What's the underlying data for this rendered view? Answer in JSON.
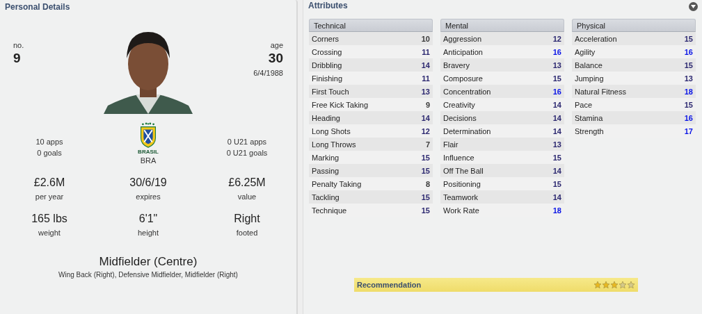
{
  "personal": {
    "title": "Personal Details",
    "number_label": "no.",
    "number": "9",
    "age_label": "age",
    "age": "30",
    "birth_date": "6/4/1988",
    "photo": {
      "kind": "picture"
    },
    "apps": [
      "10 apps",
      "0 goals"
    ],
    "crest_label": "BRASIL",
    "nation": "BRA",
    "u21": [
      "0 U21 apps",
      "0 U21 goals"
    ],
    "stats": [
      {
        "value": "£2.6M",
        "label": "per year"
      },
      {
        "value": "30/6/19",
        "label": "expires"
      },
      {
        "value": "£6.25M",
        "label": "value"
      },
      {
        "value": "165 lbs",
        "label": "weight"
      },
      {
        "value": "6'1\"",
        "label": "height"
      },
      {
        "value": "Right",
        "label": "footed"
      }
    ],
    "position": "Midfielder (Centre)",
    "other_positions": "Wing Back (Right), Defensive Midfielder, Midfielder (Right)"
  },
  "attributes": {
    "title": "Attributes",
    "groups": [
      {
        "title": "Technical",
        "items": [
          {
            "name": "Corners",
            "value": "10",
            "color": "#3a3a3a"
          },
          {
            "name": "Crossing",
            "value": "11",
            "color": "#2c2870"
          },
          {
            "name": "Dribbling",
            "value": "14",
            "color": "#2c2870"
          },
          {
            "name": "Finishing",
            "value": "11",
            "color": "#2c2870"
          },
          {
            "name": "First Touch",
            "value": "13",
            "color": "#2c2870"
          },
          {
            "name": "Free Kick Taking",
            "value": "9",
            "color": "#3a3a3a"
          },
          {
            "name": "Heading",
            "value": "14",
            "color": "#2c2870"
          },
          {
            "name": "Long Shots",
            "value": "12",
            "color": "#2c2870"
          },
          {
            "name": "Long Throws",
            "value": "7",
            "color": "#3a3a3a"
          },
          {
            "name": "Marking",
            "value": "15",
            "color": "#2c2870"
          },
          {
            "name": "Passing",
            "value": "15",
            "color": "#2c2870"
          },
          {
            "name": "Penalty Taking",
            "value": "8",
            "color": "#3a3a3a"
          },
          {
            "name": "Tackling",
            "value": "15",
            "color": "#2c2870"
          },
          {
            "name": "Technique",
            "value": "15",
            "color": "#2c2870"
          }
        ]
      },
      {
        "title": "Mental",
        "items": [
          {
            "name": "Aggression",
            "value": "12",
            "color": "#2c2870"
          },
          {
            "name": "Anticipation",
            "value": "16",
            "color": "#0a14e6"
          },
          {
            "name": "Bravery",
            "value": "13",
            "color": "#2c2870"
          },
          {
            "name": "Composure",
            "value": "15",
            "color": "#2c2870"
          },
          {
            "name": "Concentration",
            "value": "16",
            "color": "#0a14e6"
          },
          {
            "name": "Creativity",
            "value": "14",
            "color": "#2c2870"
          },
          {
            "name": "Decisions",
            "value": "14",
            "color": "#2c2870"
          },
          {
            "name": "Determination",
            "value": "14",
            "color": "#2c2870"
          },
          {
            "name": "Flair",
            "value": "13",
            "color": "#2c2870"
          },
          {
            "name": "Influence",
            "value": "15",
            "color": "#2c2870"
          },
          {
            "name": "Off The Ball",
            "value": "14",
            "color": "#2c2870"
          },
          {
            "name": "Positioning",
            "value": "15",
            "color": "#2c2870"
          },
          {
            "name": "Teamwork",
            "value": "14",
            "color": "#2c2870"
          },
          {
            "name": "Work Rate",
            "value": "18",
            "color": "#0a14e6"
          }
        ]
      },
      {
        "title": "Physical",
        "items": [
          {
            "name": "Acceleration",
            "value": "15",
            "color": "#2c2870"
          },
          {
            "name": "Agility",
            "value": "16",
            "color": "#0a14e6"
          },
          {
            "name": "Balance",
            "value": "15",
            "color": "#2c2870"
          },
          {
            "name": "Jumping",
            "value": "13",
            "color": "#2c2870"
          },
          {
            "name": "Natural Fitness",
            "value": "18",
            "color": "#0a14e6"
          },
          {
            "name": "Pace",
            "value": "15",
            "color": "#2c2870"
          },
          {
            "name": "Stamina",
            "value": "16",
            "color": "#0a14e6"
          },
          {
            "name": "Strength",
            "value": "17",
            "color": "#0a14e6"
          }
        ]
      }
    ],
    "recommendation": {
      "label": "Recommendation",
      "stars": 3
    }
  }
}
